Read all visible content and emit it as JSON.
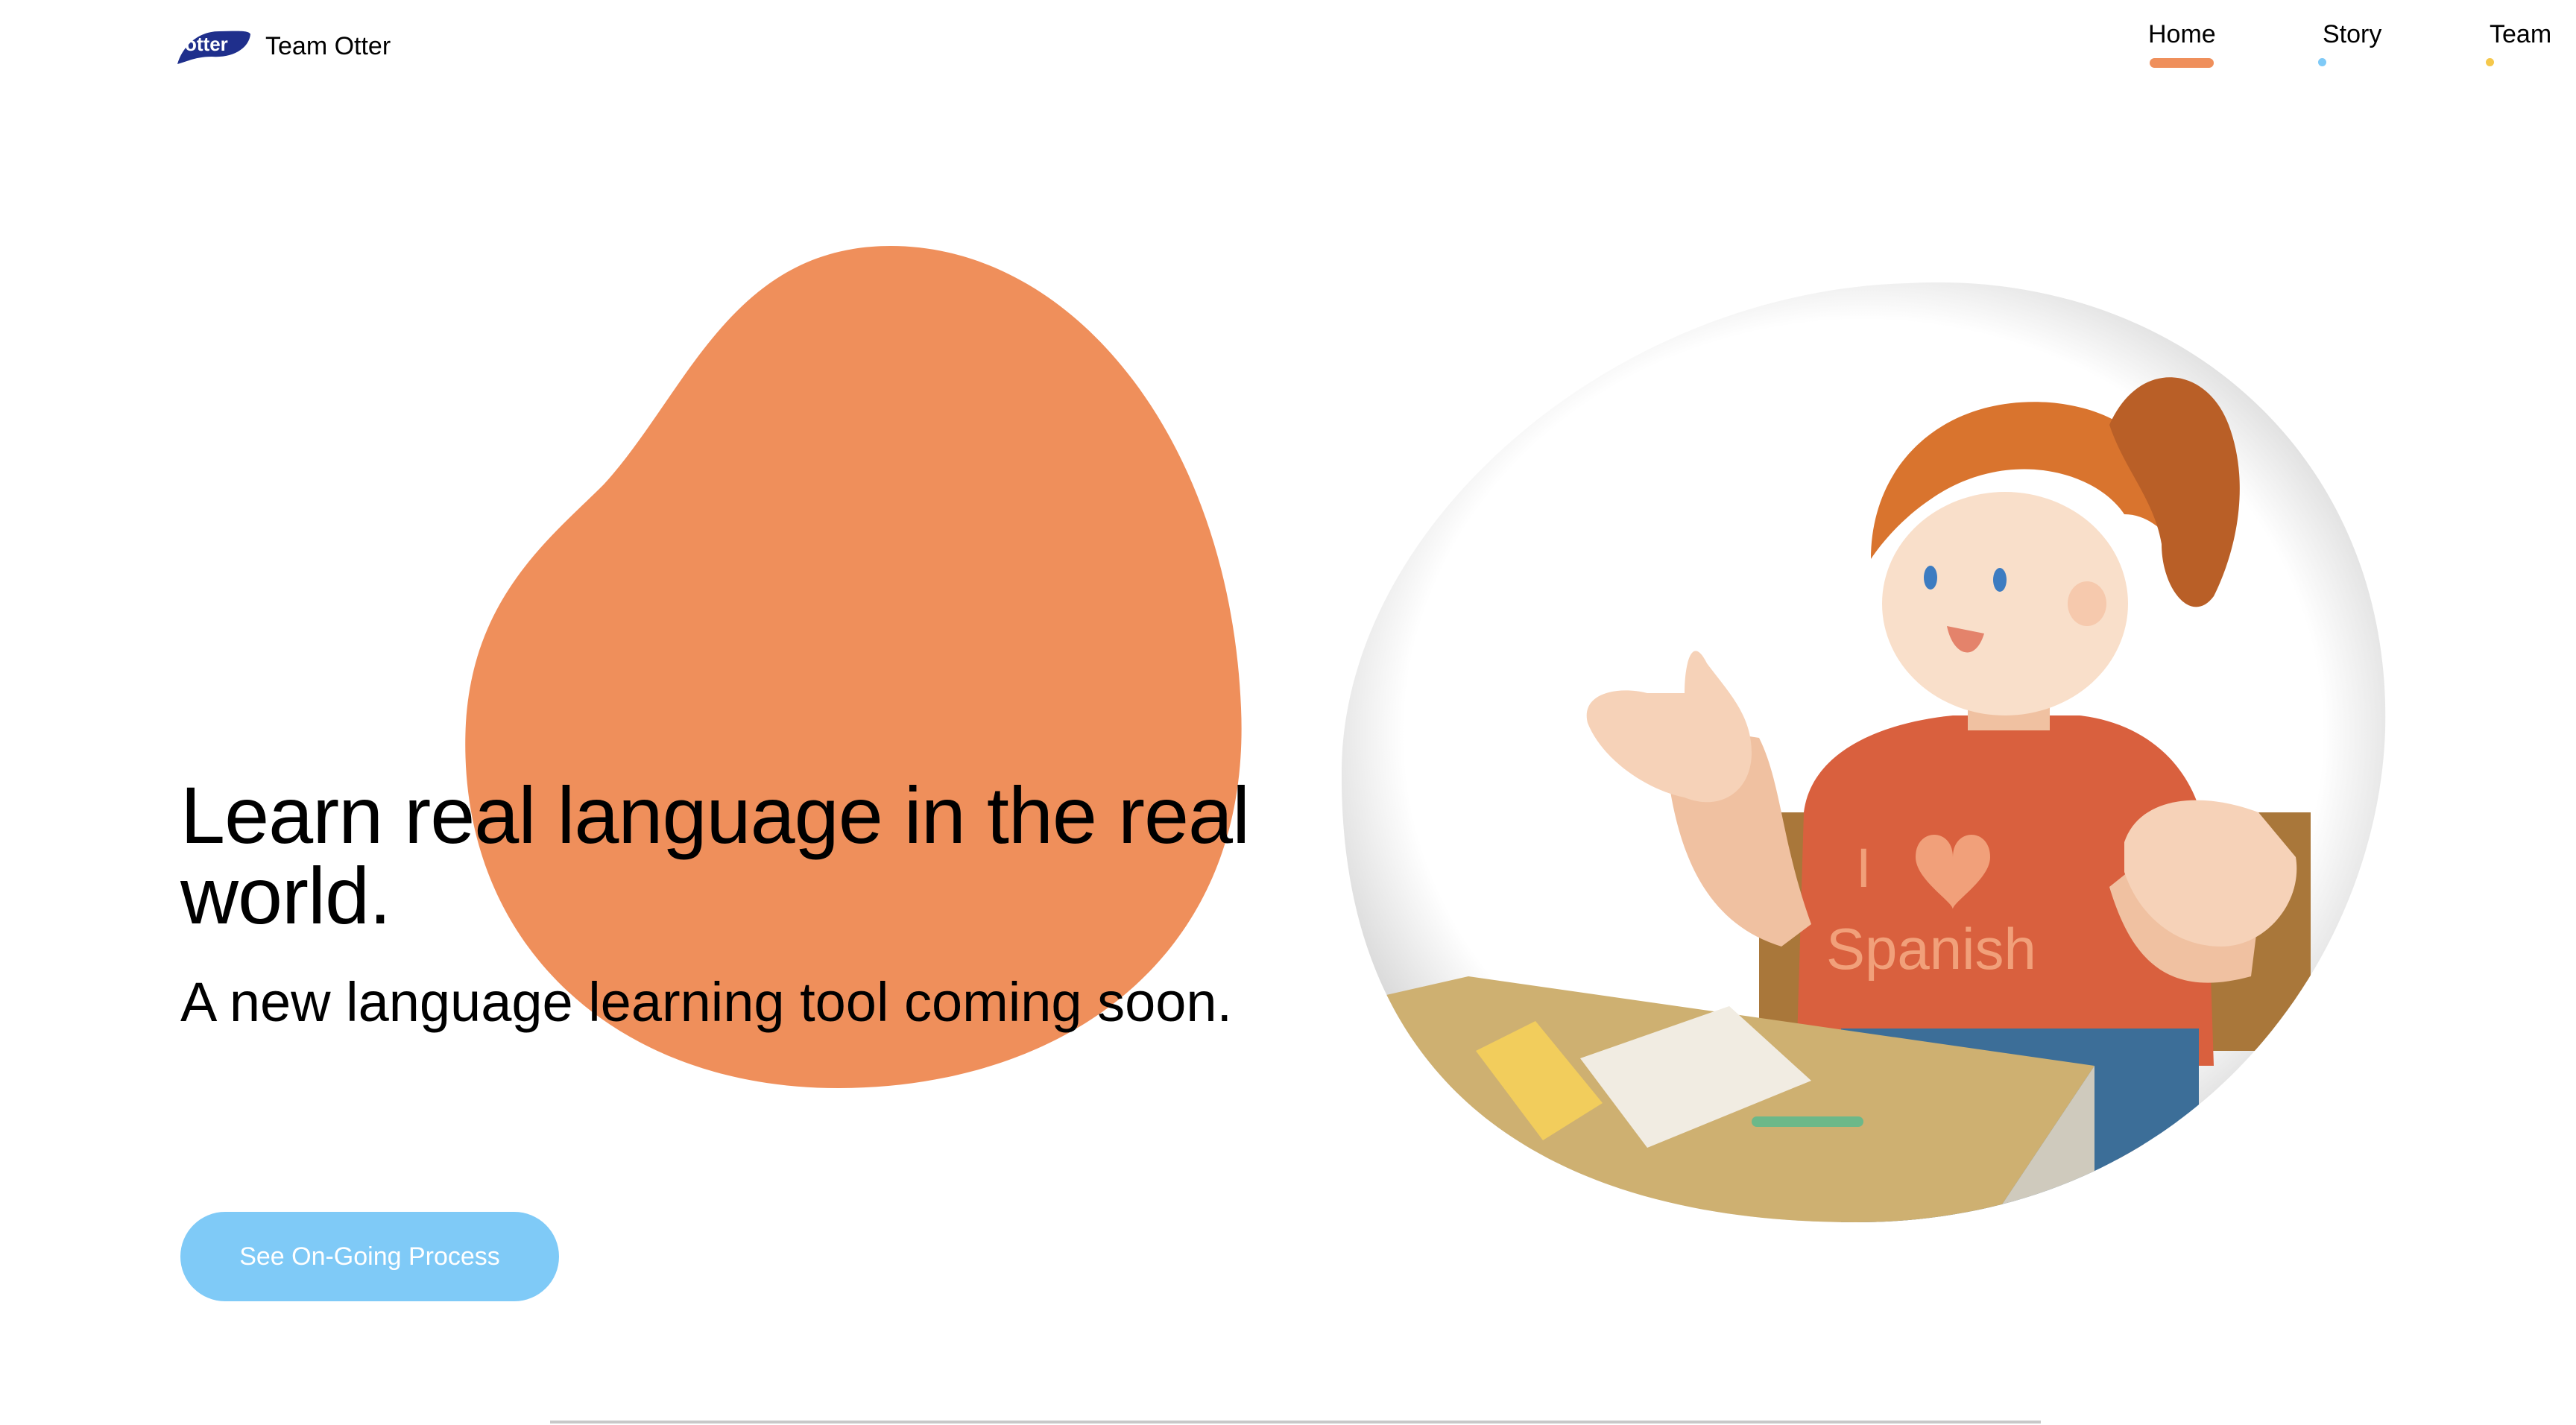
{
  "header": {
    "logo_text": "otter",
    "brand_name": "Team Otter"
  },
  "nav": {
    "items": [
      {
        "label": "Home",
        "active": true,
        "indicator_color": "#ef8f5b"
      },
      {
        "label": "Story",
        "active": false,
        "indicator_color": "#7fcaf7"
      },
      {
        "label": "Team",
        "active": false,
        "indicator_color": "#f5c84b"
      }
    ]
  },
  "hero": {
    "headline": "Learn real language in the real world.",
    "subheadline": "A new language learning tool coming soon.",
    "cta_label": "See On-Going Process"
  },
  "illustration": {
    "shirt_text_line1": "I",
    "shirt_text_line2": "Spanish"
  },
  "colors": {
    "accent_orange": "#ef8f5b",
    "button_blue": "#7fcaf7",
    "logo_navy": "#1f2f8c"
  }
}
